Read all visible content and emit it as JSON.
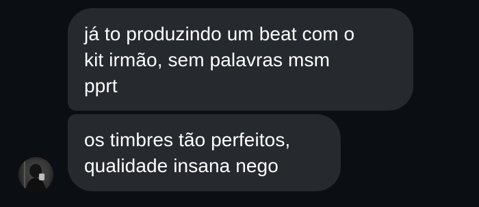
{
  "conversation": {
    "messages": [
      {
        "lines": [
          "já to produzindo um beat com o",
          "kit irmão, sem palavras msm",
          "pprt"
        ]
      },
      {
        "lines": [
          "os timbres tão perfeitos,",
          "qualidade insana nego"
        ]
      }
    ],
    "sender": {
      "avatar_icon": "user-avatar-photo"
    }
  },
  "colors": {
    "background": "#0b0e12",
    "bubble": "#26292e",
    "text": "#ffffff"
  }
}
